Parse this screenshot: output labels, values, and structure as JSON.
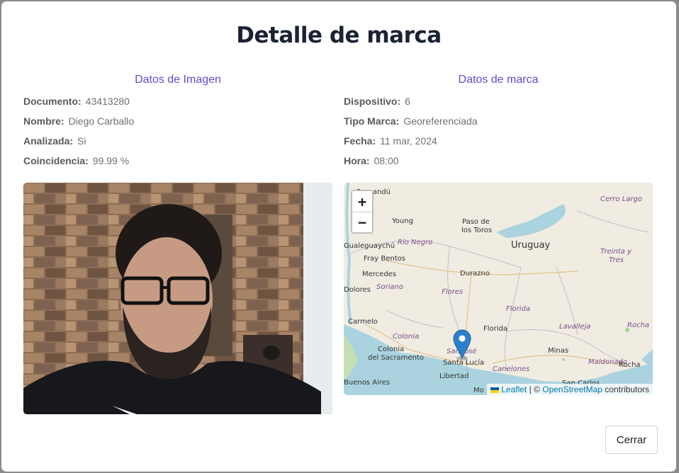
{
  "modal": {
    "title": "Detalle de marca",
    "close_label": "Cerrar"
  },
  "image_data": {
    "heading": "Datos de Imagen",
    "fields": [
      {
        "label": "Documento:",
        "value": "43413280"
      },
      {
        "label": "Nombre:",
        "value": "Diego Carballo"
      },
      {
        "label": "Analizada:",
        "value": "Si"
      },
      {
        "label": "Coincidencia:",
        "value": "99.99 %"
      }
    ]
  },
  "mark_data": {
    "heading": "Datos de marca",
    "fields": [
      {
        "label": "Dispositivo:",
        "value": "6"
      },
      {
        "label": "Tipo Marca:",
        "value": "Georeferenciada"
      },
      {
        "label": "Fecha:",
        "value": "11 mar, 2024"
      },
      {
        "label": "Hora:",
        "value": "08:00"
      }
    ]
  },
  "map": {
    "zoom_in": "+",
    "zoom_out": "−",
    "attribution_leaflet": "Leaflet",
    "attribution_sep": "| ©",
    "attribution_osm": "OpenStreetMap",
    "attribution_suffix": "contributors",
    "labels": {
      "paysandu": "Paysandú",
      "young": "Young",
      "paso": "Paso de",
      "los_toros": "los Toros",
      "uruguay": "Uruguay",
      "cerro_largo": "Cerro Largo",
      "gualeguaychu": "Gualeguaychú",
      "rio_negro": "Río Negro",
      "fray_bentos": "Fray Bentos",
      "mercedes": "Mercedes",
      "treinta": "Treinta y",
      "tres": "Tres",
      "durazno": "Durazno",
      "dolores": "Dolores",
      "soriano": "Soriano",
      "flores": "Flores",
      "florida_dept": "Florida",
      "carmelo": "Carmelo",
      "colonia_dept": "Colonia",
      "florida": "Florida",
      "lavalleja": "Lavalleja",
      "rocha_dept": "Rocha",
      "colonia_sac": "Colonia",
      "del_sacramento": "del Sacramento",
      "san_jose": "San José",
      "minas": "Minas",
      "maldonado": "Maldonado",
      "rocha": "Rocha",
      "santa_lucia": "Santa Lucía",
      "canelones": "Canelones",
      "libertad": "Libertad",
      "buenos_aires": "Buenos Aires",
      "montevideo": "Mo",
      "san_carlos": "San Carlos"
    }
  },
  "colors": {
    "accent": "#5b4fd0",
    "title": "#1b2233",
    "marker": "#2a81cb",
    "water": "#aad3df"
  }
}
